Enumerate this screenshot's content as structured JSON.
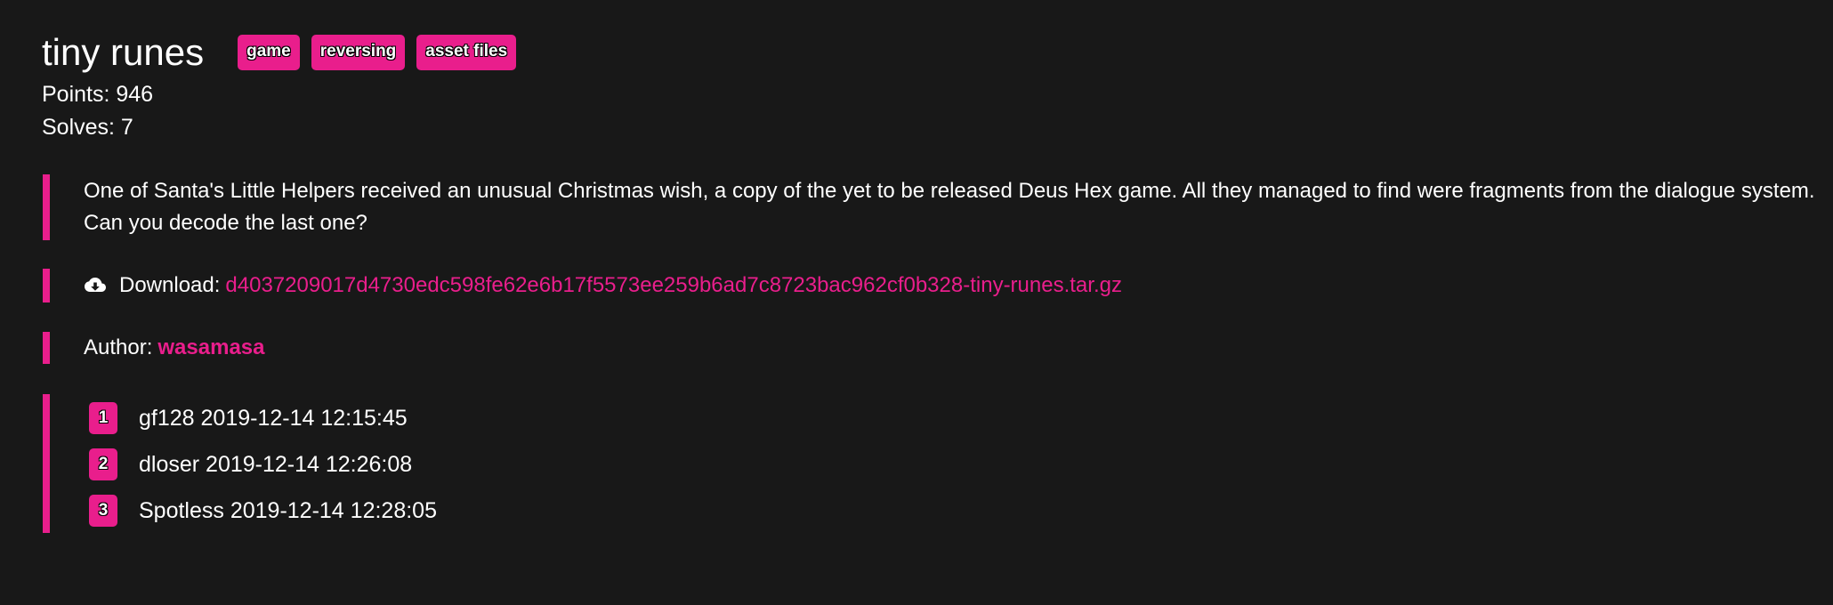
{
  "challenge": {
    "title": "tiny runes",
    "tags": [
      "game",
      "reversing",
      "asset files"
    ],
    "points_text": "Points: 946",
    "solves_text": "Solves: 7",
    "description": "One of Santa's Little Helpers received an unusual Christmas wish, a copy of the yet to be released Deus Hex game. All they managed to find were fragments from the dialogue system. Can you decode the last one?",
    "download_label": "Download:",
    "download_file": "d4037209017d4730edc598fe62e6b17f5573ee259b6ad7c8723bac962cf0b328-tiny-runes.tar.gz",
    "download_icon": "cloud-download-icon",
    "author_label": "Author:",
    "author_name": "wasamasa",
    "accent_color": "#e91e8c",
    "background_color": "#181818"
  },
  "solves": [
    {
      "rank": "1",
      "text": "gf128 2019-12-14 12:15:45"
    },
    {
      "rank": "2",
      "text": "dloser 2019-12-14 12:26:08"
    },
    {
      "rank": "3",
      "text": "Spotless 2019-12-14 12:28:05"
    }
  ]
}
